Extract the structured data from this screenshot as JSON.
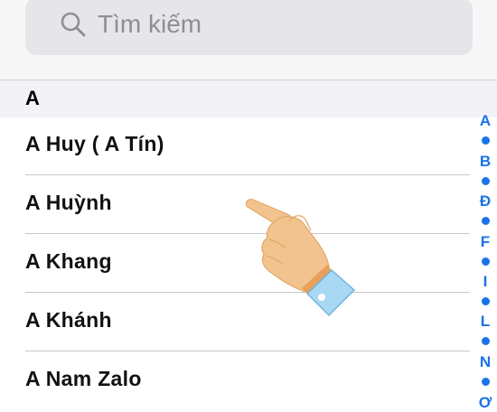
{
  "search": {
    "placeholder": "Tìm kiếm",
    "icon": "search-icon"
  },
  "section": {
    "header": "A"
  },
  "contacts": [
    {
      "name": "A Huy ( A Tín)"
    },
    {
      "name": "A Huỳnh"
    },
    {
      "name": "A Khang"
    },
    {
      "name": "A Khánh"
    },
    {
      "name": "A Nam Zalo"
    }
  ],
  "index": {
    "letters": [
      "A",
      "B",
      "Đ",
      "F",
      "I",
      "L",
      "N",
      "Ơ"
    ],
    "color": "#1a73e8"
  },
  "overlay": {
    "icon": "pointing-hand-icon"
  }
}
